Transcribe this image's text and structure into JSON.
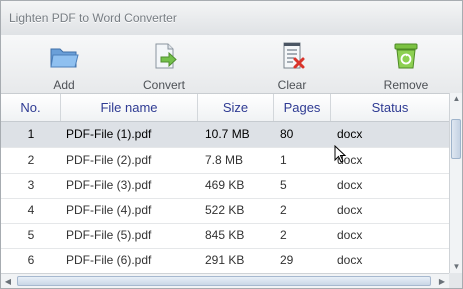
{
  "window": {
    "title": "Lighten PDF to Word Converter"
  },
  "toolbar": {
    "add_label": "Add",
    "convert_label": "Convert",
    "clear_label": "Clear",
    "remove_label": "Remove"
  },
  "table": {
    "headers": {
      "no": "No.",
      "file": "File name",
      "size": "Size",
      "pages": "Pages",
      "status": "Status"
    },
    "rows": [
      {
        "no": "1",
        "file": "PDF-File (1).pdf",
        "size": "10.7 MB",
        "pages": "80",
        "status": "docx"
      },
      {
        "no": "2",
        "file": "PDF-File (2).pdf",
        "size": "7.8 MB",
        "pages": "1",
        "status": "docx"
      },
      {
        "no": "3",
        "file": "PDF-File (3).pdf",
        "size": "469 KB",
        "pages": "5",
        "status": "docx"
      },
      {
        "no": "4",
        "file": "PDF-File (4).pdf",
        "size": "522 KB",
        "pages": "2",
        "status": "docx"
      },
      {
        "no": "5",
        "file": "PDF-File (5).pdf",
        "size": "845 KB",
        "pages": "2",
        "status": "docx"
      },
      {
        "no": "6",
        "file": "PDF-File (6).pdf",
        "size": "291 KB",
        "pages": "29",
        "status": "docx"
      }
    ],
    "selected_row": "1"
  },
  "icons": {
    "add": "folder-icon",
    "convert": "document-convert-icon",
    "clear": "document-clear-icon",
    "remove": "recycle-bin-icon"
  }
}
